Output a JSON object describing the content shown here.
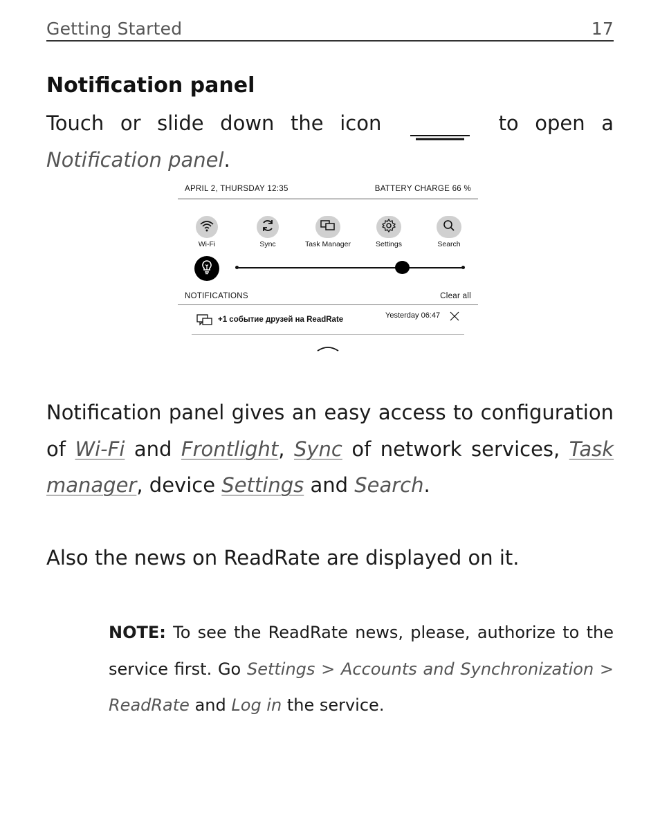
{
  "header": {
    "section": "Getting Started",
    "page_number": "17"
  },
  "section_title": "Notification panel",
  "para1": {
    "before_icon": "Touch or slide down the icon",
    "icon": "panel-handle-icon",
    "after_icon": "to open a",
    "italic_term": "Notification panel",
    "end": "."
  },
  "panel": {
    "date_time": "APRIL 2, THURSDAY 12:35",
    "battery": "BATTERY CHARGE 66 %",
    "quick_buttons": [
      {
        "label": "Wi-Fi",
        "icon": "wifi-icon"
      },
      {
        "label": "Sync",
        "icon": "sync-icon"
      },
      {
        "label": "Task Manager",
        "icon": "task-manager-icon"
      },
      {
        "label": "Settings",
        "icon": "gear-icon"
      },
      {
        "label": "Search",
        "icon": "search-icon"
      }
    ],
    "frontlight": {
      "icon": "lightbulb-icon",
      "level_fraction": 0.73
    },
    "notifications_header": "NOTIFICATIONS",
    "clear_all": "Clear all",
    "notification": {
      "icon": "readrate-event-icon",
      "text": "+1 событие друзей на ReadRate",
      "time": "Yesterday 06:47",
      "close_icon": "close-icon"
    },
    "collapse_icon": "chevron-up-icon"
  },
  "para2": {
    "t1": "Notification panel gives an easy access to configuration of",
    "link_wifi": "Wi-Fi",
    "t2": "and",
    "link_frontlight": "Frontlight",
    "t3": ",",
    "link_sync": "Sync",
    "t4": "of network services,",
    "link_task_manager": "Task manager",
    "t5": ", device",
    "link_settings": "Settings",
    "t6": "and",
    "italic_search": "Search",
    "t7": "."
  },
  "para3": "Also the news on ReadRate are displayed on it.",
  "note": {
    "label": "NOTE:",
    "t1": "To see the ReadRate news, please, authorize to the service first. Go",
    "path": "Settings > Accounts and Synchronization > ReadRate",
    "t2": "and",
    "action": "Log in",
    "t3": "the service."
  }
}
